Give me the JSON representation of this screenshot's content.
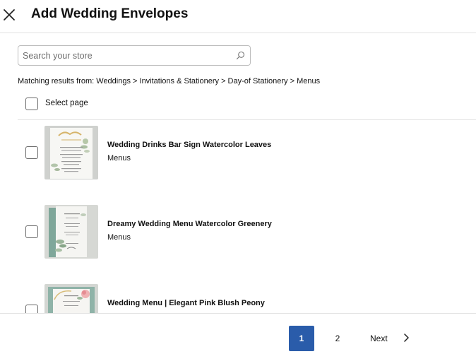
{
  "header": {
    "title": "Add Wedding Envelopes",
    "close_icon": "close-icon"
  },
  "search": {
    "placeholder": "Search your store",
    "value": "",
    "icon": "search-icon"
  },
  "breadcrumb": "Matching results from: Weddings > Invitations & Stationery > Day-of Stationery > Menus",
  "select_page": {
    "label": "Select page",
    "checked": false
  },
  "products": [
    {
      "title": "Wedding Drinks Bar Sign Watercolor Leaves",
      "category": "Menus",
      "checked": false
    },
    {
      "title": "Dreamy Wedding Menu Watercolor Greenery",
      "category": "Menus",
      "checked": false
    },
    {
      "title": "Wedding Menu | Elegant Pink Blush Peony",
      "category": "",
      "checked": false
    }
  ],
  "pagination": {
    "pages": [
      "1",
      "2"
    ],
    "current_page": "1",
    "next_label": "Next",
    "next_icon": "chevron-right-icon"
  },
  "colors": {
    "accent": "#2a5caa",
    "border": "#bdbdbd",
    "divider": "#e3e3e3"
  }
}
